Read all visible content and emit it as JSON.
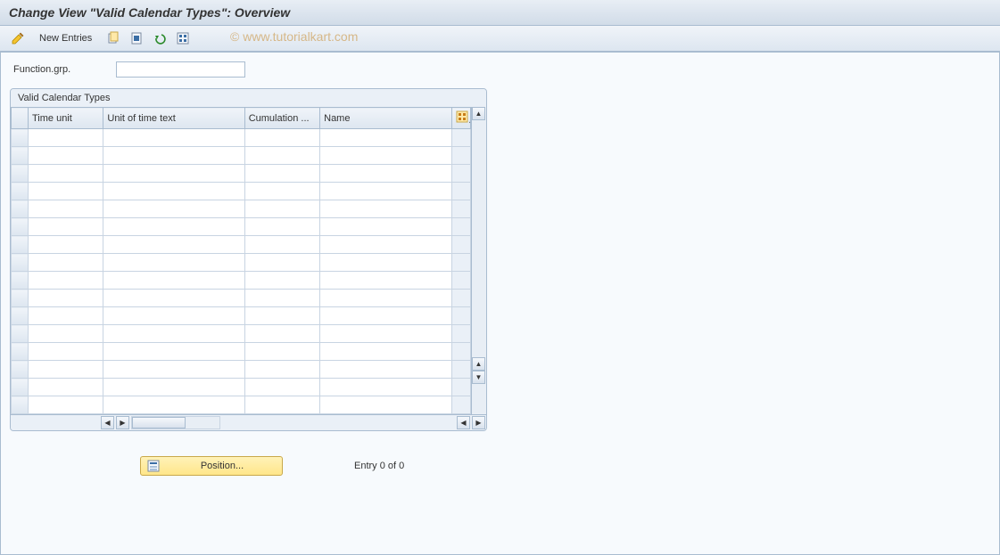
{
  "title": "Change View \"Valid Calendar Types\": Overview",
  "watermark": "© www.tutorialkart.com",
  "toolbar": {
    "new_entries_label": "New Entries",
    "icons": {
      "pencil": "pencil-icon",
      "copy": "copy-icon",
      "delete": "delete-icon",
      "undo": "undo-icon",
      "select_all": "select-all-icon"
    }
  },
  "fields": {
    "function_grp": {
      "label": "Function.grp.",
      "value": ""
    }
  },
  "table": {
    "title": "Valid Calendar Types",
    "columns": [
      "Time unit",
      "Unit of time text",
      "Cumulation ...",
      "Name"
    ],
    "rows": [
      [
        "",
        "",
        "",
        ""
      ],
      [
        "",
        "",
        "",
        ""
      ],
      [
        "",
        "",
        "",
        ""
      ],
      [
        "",
        "",
        "",
        ""
      ],
      [
        "",
        "",
        "",
        ""
      ],
      [
        "",
        "",
        "",
        ""
      ],
      [
        "",
        "",
        "",
        ""
      ],
      [
        "",
        "",
        "",
        ""
      ],
      [
        "",
        "",
        "",
        ""
      ],
      [
        "",
        "",
        "",
        ""
      ],
      [
        "",
        "",
        "",
        ""
      ],
      [
        "",
        "",
        "",
        ""
      ],
      [
        "",
        "",
        "",
        ""
      ],
      [
        "",
        "",
        "",
        ""
      ],
      [
        "",
        "",
        "",
        ""
      ],
      [
        "",
        "",
        "",
        ""
      ]
    ]
  },
  "footer": {
    "position_label": "Position...",
    "entry_text": "Entry 0 of 0"
  }
}
